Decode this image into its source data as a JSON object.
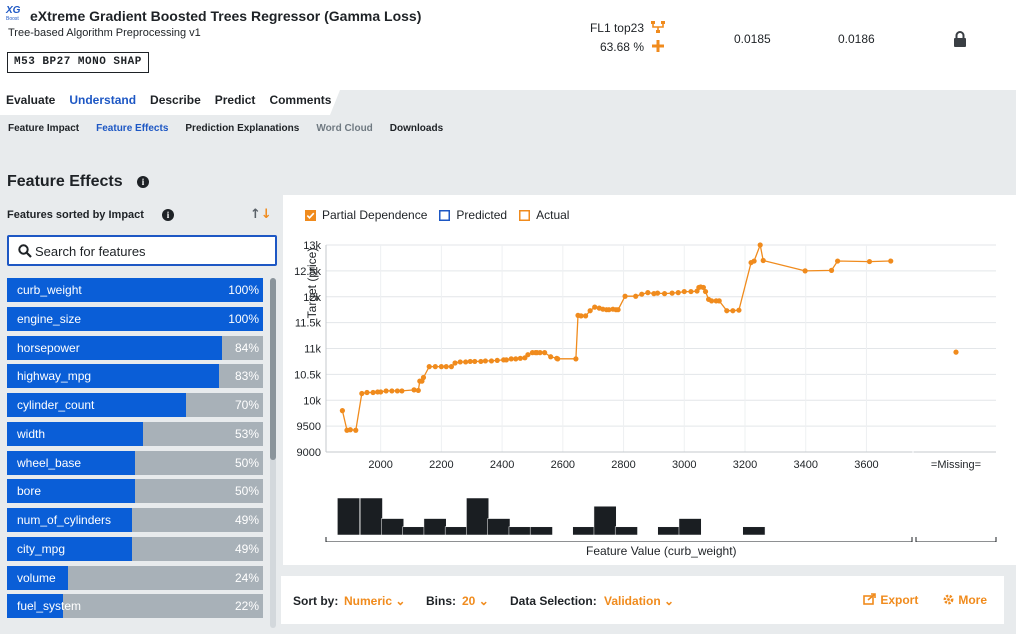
{
  "header": {
    "logo_text": "XG",
    "logo_sub": "Boost",
    "title": "eXtreme Gradient Boosted Trees Regressor (Gamma Loss)",
    "subtitle": "Tree-based Algorithm Preprocessing v1",
    "tags": "M53  BP27  MONO  SHAP",
    "top_line": "FL1 top23",
    "percent": "63.68 %",
    "metric_1": "0.0185",
    "metric_2": "0.0186",
    "icons": [
      "model-tree-icon",
      "plus-icon",
      "lock-icon"
    ]
  },
  "main_tabs": [
    "Evaluate",
    "Understand",
    "Describe",
    "Predict",
    "Comments"
  ],
  "sub_tabs": [
    "Feature Impact",
    "Feature Effects",
    "Prediction Explanations",
    "Word Cloud",
    "Downloads"
  ],
  "section": {
    "title": "Feature Effects",
    "list_title": "Features sorted by Impact",
    "search_placeholder": "Search for features"
  },
  "features": [
    {
      "name": "curb_weight",
      "pct": "100%",
      "value": 1.0
    },
    {
      "name": "engine_size",
      "pct": "100%",
      "value": 1.0
    },
    {
      "name": "horsepower",
      "pct": "84%",
      "value": 0.84
    },
    {
      "name": "highway_mpg",
      "pct": "83%",
      "value": 0.83
    },
    {
      "name": "cylinder_count",
      "pct": "70%",
      "value": 0.7
    },
    {
      "name": "width",
      "pct": "53%",
      "value": 0.53
    },
    {
      "name": "wheel_base",
      "pct": "50%",
      "value": 0.5
    },
    {
      "name": "bore",
      "pct": "50%",
      "value": 0.5
    },
    {
      "name": "num_of_cylinders",
      "pct": "49%",
      "value": 0.49
    },
    {
      "name": "city_mpg",
      "pct": "49%",
      "value": 0.49
    },
    {
      "name": "volume",
      "pct": "24%",
      "value": 0.24
    },
    {
      "name": "fuel_system",
      "pct": "22%",
      "value": 0.22
    }
  ],
  "legend": [
    "Partial Dependence",
    "Predicted",
    "Actual"
  ],
  "colors": {
    "accent": "#1d57c4",
    "bar_fill": "#0a5ed7",
    "bar_bg": "#a8b1b8",
    "orange": "#f08b1d",
    "histogram": "#1a1e22"
  },
  "chart_data": {
    "type": "line",
    "ylabel": "Target (price)",
    "xlabel": "Feature Value (curb_weight)",
    "ylim": [
      9000,
      13000
    ],
    "xlim": [
      1820,
      3750
    ],
    "yticks": [
      "9000",
      "9500",
      "10k",
      "10.5k",
      "11k",
      "11.5k",
      "12k",
      "12.5k",
      "13k"
    ],
    "ytick_values": [
      9000,
      9500,
      10000,
      10500,
      11000,
      11500,
      12000,
      12500,
      13000
    ],
    "xticks": [
      "2000",
      "2200",
      "2400",
      "2600",
      "2800",
      "3000",
      "3200",
      "3400",
      "3600"
    ],
    "xtick_values": [
      2000,
      2200,
      2400,
      2600,
      2800,
      3000,
      3200,
      3400,
      3600
    ],
    "missing_label": "=Missing=",
    "missing_value": 10930,
    "series": [
      {
        "name": "Partial Dependence",
        "x": [
          1874,
          1889,
          1900,
          1918,
          1938,
          1955,
          1975,
          1990,
          2000,
          2018,
          2037,
          2055,
          2070,
          2110,
          2124,
          2129,
          2136,
          2141,
          2160,
          2180,
          2200,
          2216,
          2233,
          2245,
          2262,
          2280,
          2295,
          2310,
          2330,
          2345,
          2365,
          2384,
          2405,
          2414,
          2430,
          2445,
          2460,
          2475,
          2485,
          2500,
          2510,
          2515,
          2525,
          2540,
          2560,
          2580,
          2583,
          2643,
          2650,
          2660,
          2675,
          2690,
          2705,
          2720,
          2732,
          2744,
          2752,
          2765,
          2775,
          2782,
          2805,
          2840,
          2860,
          2880,
          2900,
          2912,
          2935,
          2960,
          2980,
          3000,
          3022,
          3042,
          3048,
          3054,
          3063,
          3070,
          3080,
          3090,
          3105,
          3115,
          3140,
          3160,
          3180,
          3220,
          3230,
          3250,
          3260,
          3398,
          3485,
          3505,
          3610,
          3680
        ],
        "y": [
          9800,
          9420,
          9430,
          9420,
          10130,
          10150,
          10150,
          10160,
          10160,
          10180,
          10180,
          10180,
          10180,
          10200,
          10190,
          10370,
          10370,
          10440,
          10650,
          10650,
          10650,
          10650,
          10650,
          10720,
          10740,
          10740,
          10750,
          10750,
          10750,
          10760,
          10760,
          10770,
          10780,
          10780,
          10800,
          10800,
          10810,
          10820,
          10880,
          10920,
          10920,
          10920,
          10920,
          10920,
          10840,
          10810,
          10800,
          10800,
          11640,
          11630,
          11630,
          11730,
          11800,
          11780,
          11760,
          11750,
          11750,
          11760,
          11750,
          11750,
          12010,
          12010,
          12050,
          12080,
          12060,
          12070,
          12060,
          12070,
          12080,
          12100,
          12100,
          12110,
          12180,
          12190,
          12180,
          12100,
          11950,
          11920,
          11920,
          11920,
          11730,
          11730,
          11740,
          12660,
          12690,
          13000,
          12700,
          12500,
          12510,
          12690,
          12680,
          12690
        ]
      }
    ],
    "histogram": {
      "bins_x": [
        1880,
        1955,
        2025,
        2095,
        2165,
        2235,
        2305,
        2375,
        2445,
        2515,
        2585,
        2655,
        2725,
        2795,
        2865,
        2935,
        3005,
        3075,
        3145,
        3215
      ],
      "counts": [
        9,
        9,
        4,
        2,
        4,
        2,
        9,
        4,
        2,
        2,
        0,
        2,
        7,
        2,
        0,
        2,
        4,
        0,
        0,
        2
      ]
    }
  },
  "bottom_bar": {
    "sort_label": "Sort by:",
    "sort_value": "Numeric",
    "bins_label": "Bins:",
    "bins_value": "20",
    "selection_label": "Data Selection:",
    "selection_value": "Validation",
    "export_label": "Export",
    "more_label": "More"
  }
}
